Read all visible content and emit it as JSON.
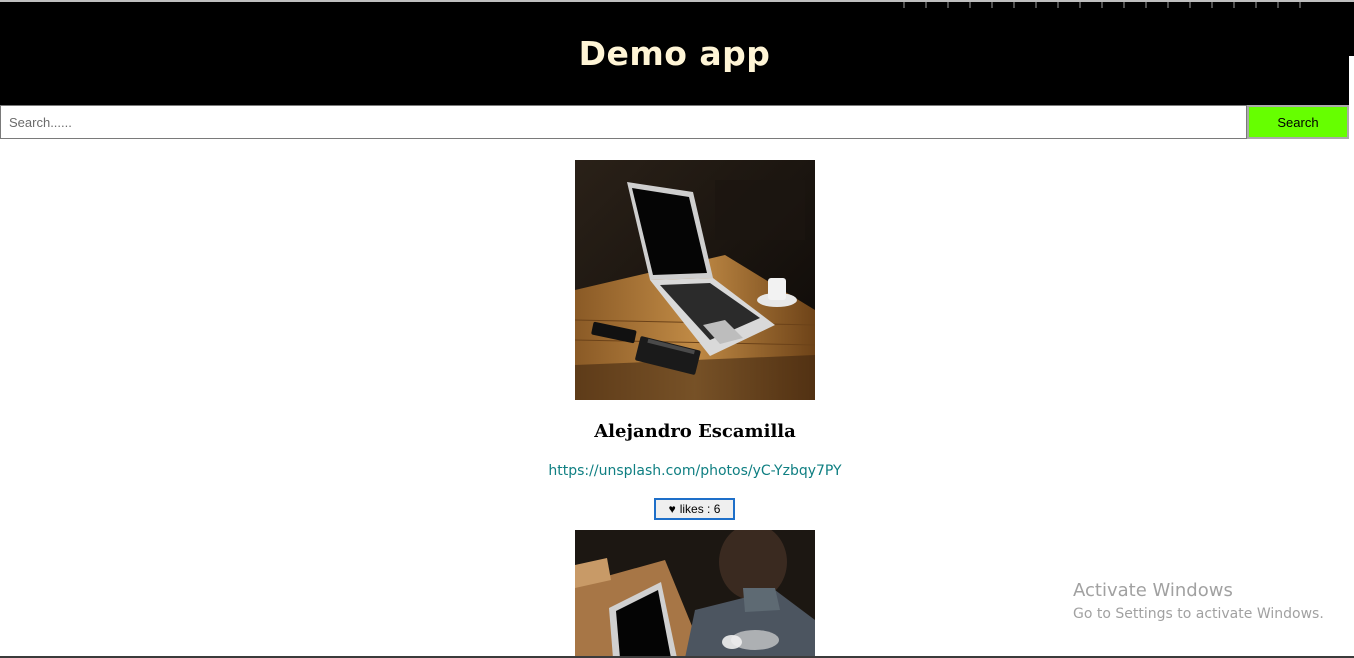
{
  "app": {
    "title": "Demo app"
  },
  "search": {
    "placeholder": "Search......",
    "value": "",
    "button_label": "Search",
    "button_color": "#66ff00"
  },
  "photos": [
    {
      "author": "Alejandro Escamilla",
      "url": "https://unsplash.com/photos/yC-Yzbqy7PY",
      "likes_label": "likes : 6",
      "heart_icon": "♥",
      "image": "laptop-on-wooden-table-photo"
    },
    {
      "image": "man-using-laptop-photo"
    }
  ],
  "watermark": {
    "title": "Activate Windows",
    "subtitle": "Go to Settings to activate Windows."
  },
  "colors": {
    "header_bg": "#000000",
    "title_color": "#fff5d6",
    "link_color": "#0f7f82",
    "likes_border": "#1e6fc9"
  }
}
